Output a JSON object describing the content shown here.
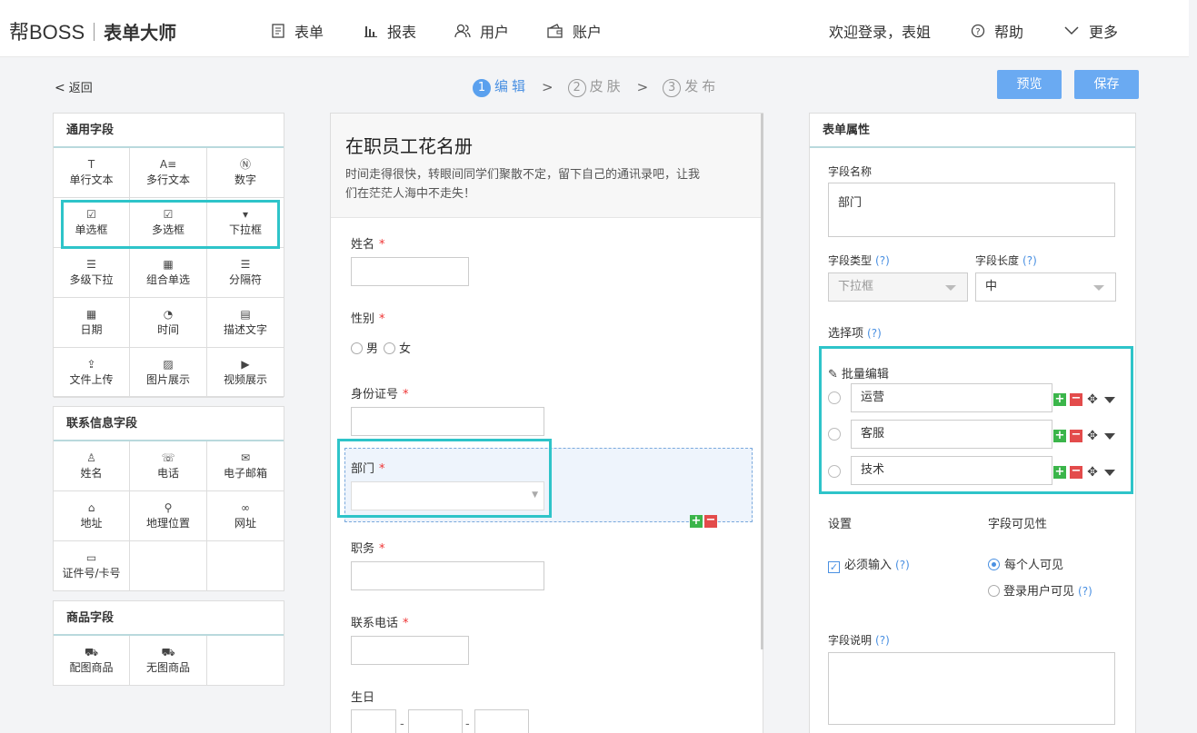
{
  "header": {
    "brand": "帮BOSS",
    "product": "表单大师",
    "nav": [
      {
        "label": "表单",
        "icon": "form-icon"
      },
      {
        "label": "报表",
        "icon": "chart-icon"
      },
      {
        "label": "用户",
        "icon": "users-icon"
      },
      {
        "label": "账户",
        "icon": "wallet-icon"
      }
    ],
    "welcome": "欢迎登录，表姐",
    "help": "帮助",
    "more": "更多"
  },
  "toolbar": {
    "back": "返回",
    "steps": [
      {
        "num": "1",
        "label": "编辑"
      },
      {
        "num": "2",
        "label": "皮肤"
      },
      {
        "num": "3",
        "label": "发布"
      }
    ],
    "preview": "预览",
    "save": "保存"
  },
  "left": {
    "common_title": "通用字段",
    "common": [
      {
        "label": "单行文本",
        "icon": "T"
      },
      {
        "label": "多行文本",
        "icon": "A≡"
      },
      {
        "label": "数字",
        "icon": "Ⓝ"
      },
      {
        "label": "单选框",
        "icon": "☑"
      },
      {
        "label": "多选框",
        "icon": "☑"
      },
      {
        "label": "下拉框",
        "icon": "▾"
      },
      {
        "label": "多级下拉",
        "icon": "☰"
      },
      {
        "label": "组合单选",
        "icon": "▦"
      },
      {
        "label": "分隔符",
        "icon": "☰"
      },
      {
        "label": "日期",
        "icon": "▦"
      },
      {
        "label": "时间",
        "icon": "◔"
      },
      {
        "label": "描述文字",
        "icon": "▤"
      },
      {
        "label": "文件上传",
        "icon": "⇪"
      },
      {
        "label": "图片展示",
        "icon": "▨"
      },
      {
        "label": "视频展示",
        "icon": "▶"
      }
    ],
    "contact_title": "联系信息字段",
    "contact": [
      {
        "label": "姓名",
        "icon": "♙"
      },
      {
        "label": "电话",
        "icon": "☏"
      },
      {
        "label": "电子邮箱",
        "icon": "✉"
      },
      {
        "label": "地址",
        "icon": "⌂"
      },
      {
        "label": "地理位置",
        "icon": "⚲"
      },
      {
        "label": "网址",
        "icon": "∞"
      },
      {
        "label": "证件号/卡号",
        "icon": "▭"
      },
      {
        "label": "",
        "icon": ""
      },
      {
        "label": "",
        "icon": ""
      }
    ],
    "goods_title": "商品字段",
    "goods": [
      {
        "label": "配图商品",
        "icon": "⛟"
      },
      {
        "label": "无图商品",
        "icon": "⛟"
      },
      {
        "label": "",
        "icon": ""
      }
    ]
  },
  "form": {
    "title": "在职员工花名册",
    "desc_line1": "时间走得很快，转眼间同学们聚散不定，留下自己的通讯录吧，让我",
    "desc_line2": "们在茫茫人海中不走失！",
    "name": "姓名",
    "gender": "性别",
    "male": "男",
    "female": "女",
    "id": "身份证号",
    "dept": "部门",
    "job": "职务",
    "phone": "联系电话",
    "birthday": "生日",
    "required": "*",
    "date_sep": "-"
  },
  "props": {
    "title": "表单属性",
    "field_name_label": "字段名称",
    "field_name_value": "部门",
    "field_type_label": "字段类型",
    "field_type_value": "下拉框",
    "field_len_label": "字段长度",
    "field_len_value": "中",
    "help": "(?)",
    "options_label": "选择项",
    "batch_edit": "批量编辑",
    "options": [
      "运营",
      "客服",
      "技术"
    ],
    "settings_label": "设置",
    "required_label": "必须输入",
    "visibility_label": "字段可见性",
    "vis_all": "每个人可见",
    "vis_login": "登录用户可见",
    "desc_label": "字段说明"
  }
}
